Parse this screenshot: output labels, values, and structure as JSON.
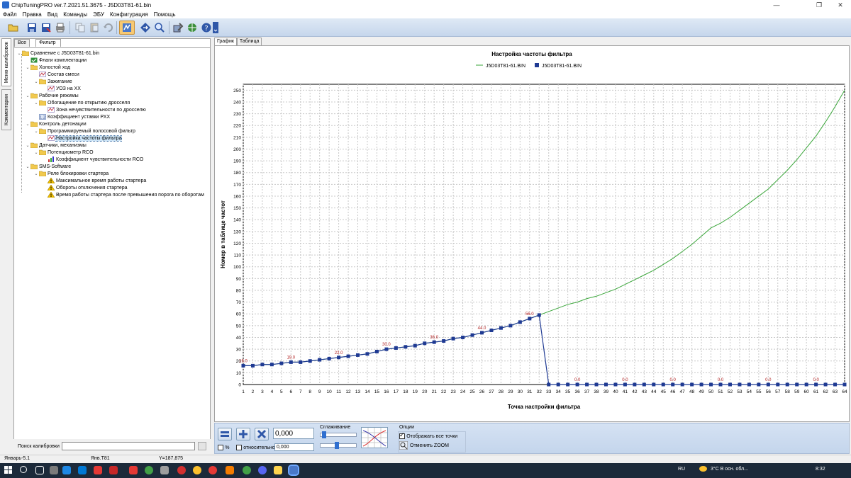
{
  "window": {
    "title": "ChipTuningPRO ver.7.2021.51.3675 - J5D03T81-61.bin"
  },
  "menu": [
    "Файл",
    "Правка",
    "Вид",
    "Команды",
    "ЭБУ",
    "Конфигурация",
    "Помощь"
  ],
  "side_tabs": [
    "Меню калибровок",
    "Комментарии"
  ],
  "left_tabs": [
    "Все",
    "Фильтр"
  ],
  "tree": [
    {
      "level": 0,
      "type": "folder",
      "label": "Сравнение с J5D03T81-61.bin"
    },
    {
      "level": 1,
      "type": "flag",
      "label": "Флаги комплектации"
    },
    {
      "level": 1,
      "type": "folder",
      "label": "Холостой ход"
    },
    {
      "level": 2,
      "type": "map",
      "label": "Состав смеси"
    },
    {
      "level": 2,
      "type": "folder",
      "label": "Зажигание"
    },
    {
      "level": 3,
      "type": "map",
      "label": "УОЗ на ХХ"
    },
    {
      "level": 1,
      "type": "folder",
      "label": "Рабочие режимы"
    },
    {
      "level": 2,
      "type": "folder",
      "label": "Обогащение по открытию дросселя"
    },
    {
      "level": 3,
      "type": "map",
      "label": "Зона нечувствительности по дросселю"
    },
    {
      "level": 2,
      "type": "const",
      "label": "Коэффициент уставки РХХ"
    },
    {
      "level": 1,
      "type": "folder",
      "label": "Контроль детонации"
    },
    {
      "level": 2,
      "type": "folder",
      "label": "Программируемый полосовой фильтр"
    },
    {
      "level": 3,
      "type": "map",
      "label": "Настройка частоты фильтра",
      "selected": true
    },
    {
      "level": 1,
      "type": "folder",
      "label": "Датчики, механизмы"
    },
    {
      "level": 2,
      "type": "folder",
      "label": "Потенциометр RCO"
    },
    {
      "level": 3,
      "type": "chart",
      "label": "Коэффициент чувствительности RCO"
    },
    {
      "level": 1,
      "type": "folder",
      "label": "SMS-Software"
    },
    {
      "level": 2,
      "type": "folder",
      "label": "Реле блокировки стартера"
    },
    {
      "level": 3,
      "type": "warn",
      "label": "Максимальное время работы стартера"
    },
    {
      "level": 3,
      "type": "warn",
      "label": "Обороты отключения стартера"
    },
    {
      "level": 3,
      "type": "warn",
      "label": "Время работы стартера после превышения порога по оборотам"
    }
  ],
  "search": {
    "label": "Поиск калибровки"
  },
  "right_tabs": [
    "График",
    "Таблица"
  ],
  "chart_data": {
    "type": "line",
    "title": "Настройка частоты фильтра",
    "xlabel": "Точка настройки фильтра",
    "ylabel": "Номер в таблице частот",
    "x": [
      1,
      2,
      3,
      4,
      5,
      6,
      7,
      8,
      9,
      10,
      11,
      12,
      13,
      14,
      15,
      16,
      17,
      18,
      19,
      20,
      21,
      22,
      23,
      24,
      25,
      26,
      27,
      28,
      29,
      30,
      31,
      32,
      33,
      34,
      35,
      36,
      37,
      38,
      39,
      40,
      41,
      42,
      43,
      44,
      45,
      46,
      47,
      48,
      49,
      50,
      51,
      52,
      53,
      54,
      55,
      56,
      57,
      58,
      59,
      60,
      61,
      62,
      63,
      64
    ],
    "xlim": [
      1,
      64
    ],
    "ylim": [
      0,
      255
    ],
    "yticks": [
      0,
      10,
      20,
      30,
      40,
      50,
      60,
      70,
      80,
      90,
      100,
      110,
      120,
      130,
      140,
      150,
      160,
      170,
      180,
      190,
      200,
      210,
      220,
      230,
      240,
      250
    ],
    "grid": true,
    "legend_position": "top-center",
    "series": [
      {
        "name": "J5D03T81-61.BIN",
        "style": "line",
        "color": "#3aa63a",
        "values": [
          16,
          16,
          17,
          17,
          18,
          19,
          19,
          20,
          21,
          22,
          23,
          24,
          25,
          26,
          28,
          30,
          31,
          32,
          33,
          35,
          36,
          37,
          39,
          40,
          42,
          44,
          46,
          48,
          50,
          53,
          56,
          59,
          62,
          65,
          68,
          70,
          73,
          75,
          78,
          81,
          85,
          89,
          93,
          97,
          102,
          107,
          113,
          119,
          126,
          133,
          137,
          142,
          148,
          154,
          160,
          166,
          174,
          182,
          191,
          201,
          211,
          223,
          236,
          250
        ]
      },
      {
        "name": "J5D03T81-61.BIN",
        "style": "markers",
        "color": "#1f3a93",
        "values": [
          16,
          16,
          17,
          17,
          18,
          19,
          19,
          20,
          21,
          22,
          23,
          24,
          25,
          26,
          28,
          30,
          31,
          32,
          33,
          35,
          36,
          37,
          39,
          40,
          42,
          44,
          46,
          48,
          50,
          53,
          56,
          59,
          0,
          0,
          0,
          0,
          0,
          0,
          0,
          0,
          0,
          0,
          0,
          0,
          0,
          0,
          0,
          0,
          0,
          0,
          0,
          0,
          0,
          0,
          0,
          0,
          0,
          0,
          0,
          0,
          0,
          0,
          0,
          0
        ]
      }
    ],
    "annotations": [
      {
        "x": 1,
        "label": "16.0"
      },
      {
        "x": 6,
        "label": "19.0"
      },
      {
        "x": 11,
        "label": "22.0"
      },
      {
        "x": 16,
        "label": "30.0"
      },
      {
        "x": 21,
        "label": "36.0"
      },
      {
        "x": 26,
        "label": "44.0"
      },
      {
        "x": 31,
        "label": "56.0"
      },
      {
        "x": 36,
        "label": "0.0"
      },
      {
        "x": 41,
        "label": "0.0"
      },
      {
        "x": 46,
        "label": "0.0"
      },
      {
        "x": 51,
        "label": "0.0"
      },
      {
        "x": 56,
        "label": "0.0"
      },
      {
        "x": 61,
        "label": "0.0"
      }
    ]
  },
  "bottom": {
    "value": "0,000",
    "percent_label": "%",
    "relative_label": "относительно",
    "relative_value": "0,000",
    "smoothing_label": "Сглаживание",
    "options_label": "Опции",
    "show_all_points": "Отображать все точки",
    "cancel_zoom": "Отменить ZOOM"
  },
  "statusbar": {
    "s1": "Январь-5.1",
    "s2": "Янв.Т81",
    "s3": "Y=187,875"
  },
  "taskbar": {
    "lang": "RU",
    "weather": "3°C  В осн. обл...",
    "time": "8:32"
  }
}
